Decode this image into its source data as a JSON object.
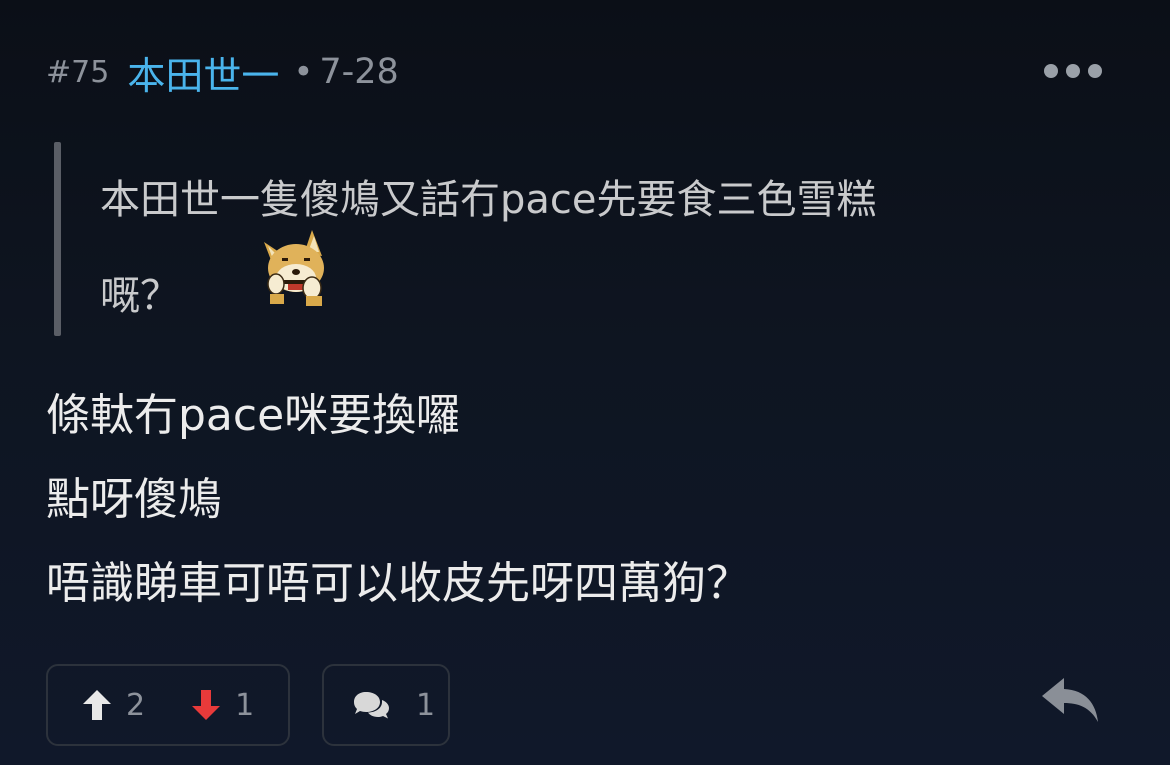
{
  "post": {
    "floor": "#75",
    "username": "本田世一",
    "separator": "•",
    "date": "7-28"
  },
  "quote": {
    "line1": "本田世一隻傻鳩又話冇pace先要食三色雪糕",
    "line2": "嘅？"
  },
  "content": {
    "lines": [
      "條軚冇pace咪要換囉",
      "點呀傻鳩",
      "唔識睇車可唔可以收皮先呀四萬狗？"
    ]
  },
  "votes": {
    "up": "2",
    "down": "1"
  },
  "replies": {
    "count": "1"
  },
  "icons": {
    "more": "more-dots-icon",
    "upvote": "up-arrow-icon",
    "downvote": "down-arrow-icon",
    "reply": "speech-bubbles-icon",
    "quote_reply": "reply-arrow-icon",
    "sticker": "shiba-dog-sticker"
  },
  "colors": {
    "username": "#4ab4ec",
    "upvote": "#e8e8e8",
    "downvote": "#e83a3a",
    "meta": "#8d929b"
  }
}
